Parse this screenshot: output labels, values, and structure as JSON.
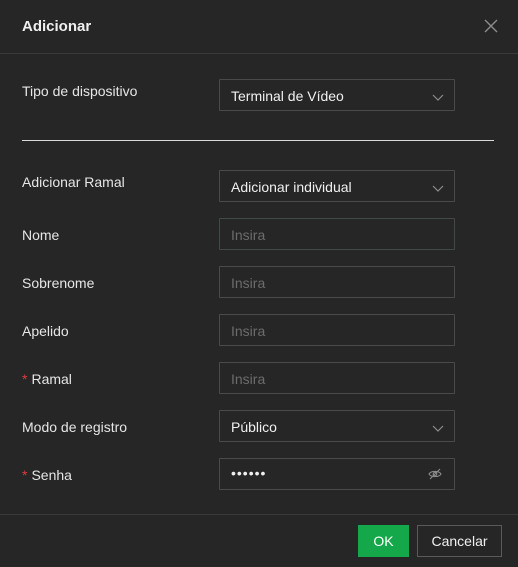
{
  "dialog": {
    "title": "Adicionar",
    "close_label": "X"
  },
  "device_type": {
    "label": "Tipo de dispositivo",
    "value": "Terminal de Vídeo"
  },
  "form": {
    "add_extension": {
      "label": "Adicionar Ramal",
      "value": "Adicionar individual"
    },
    "first_name": {
      "label": "Nome",
      "placeholder": "Insira"
    },
    "last_name": {
      "label": "Sobrenome",
      "placeholder": "Insira"
    },
    "nickname": {
      "label": "Apelido",
      "placeholder": "Insira"
    },
    "extension": {
      "label": "Ramal",
      "placeholder": "Insira",
      "required_mark": "*"
    },
    "registration_mode": {
      "label": "Modo de registro",
      "value": "Público"
    },
    "password": {
      "label": "Senha",
      "value": "••••••",
      "required_mark": "*"
    }
  },
  "footer": {
    "ok_label": "OK",
    "cancel_label": "Cancelar"
  },
  "colors": {
    "background": "#262626",
    "primary": "#15a84a",
    "required": "#e03c3c"
  }
}
